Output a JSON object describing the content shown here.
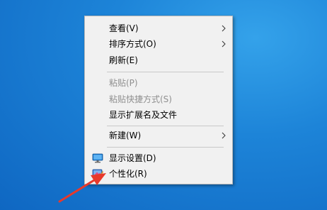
{
  "context_menu": {
    "items": [
      {
        "label": "查看(V)",
        "enabled": true,
        "has_submenu": true
      },
      {
        "label": "排序方式(O)",
        "enabled": true,
        "has_submenu": true
      },
      {
        "label": "刷新(E)",
        "enabled": true,
        "has_submenu": false
      },
      {
        "label": "粘贴(P)",
        "enabled": false,
        "has_submenu": false
      },
      {
        "label": "粘贴快捷方式(S)",
        "enabled": false,
        "has_submenu": false
      },
      {
        "label": "显示扩展名及文件",
        "enabled": true,
        "has_submenu": false
      },
      {
        "label": "新建(W)",
        "enabled": true,
        "has_submenu": true
      },
      {
        "label": "显示设置(D)",
        "enabled": true,
        "has_submenu": false,
        "icon": "display-settings-icon"
      },
      {
        "label": "个性化(R)",
        "enabled": true,
        "has_submenu": false,
        "icon": "personalize-icon"
      }
    ]
  },
  "colors": {
    "desktop_blue": "#1d84d8",
    "menu_background": "#f1f1f1",
    "disabled_text": "#8f8f8f",
    "annotation_arrow": "#e8392b"
  },
  "annotation": {
    "icon": "red-arrow-icon",
    "points_to": "个性化(R)"
  }
}
